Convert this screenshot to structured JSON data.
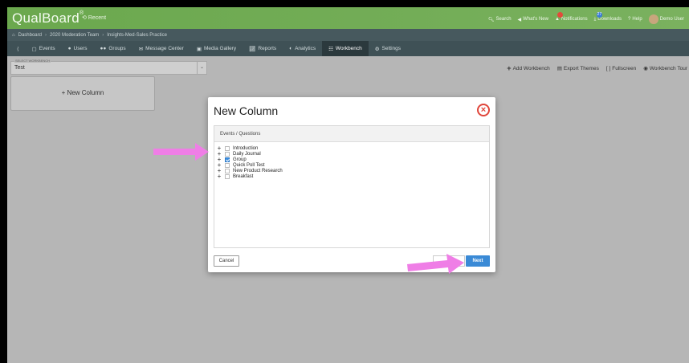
{
  "app": {
    "brand": "QualBoard",
    "brand_mark": "®",
    "recent": "Recent"
  },
  "topbar_right": {
    "search": "Search",
    "whats_new": "What's New",
    "notifications": "Notifications",
    "notifications_badge": "27",
    "downloads": "Downloads",
    "help": "Help",
    "user": "Demo User"
  },
  "breadcrumb": [
    "Dashboard",
    "2020 Moderation Team",
    "Insights-Med-Sales Practice"
  ],
  "nav": {
    "events": "Events",
    "users": "Users",
    "groups": "Groups",
    "message_center": "Message Center",
    "media_gallery": "Media Gallery",
    "reports": "Reports",
    "analytics": "Analytics",
    "workbench": "Workbench",
    "settings": "Settings"
  },
  "workbench_select": {
    "label": "SELECT WORKBENCH",
    "value": "Test"
  },
  "toolbar": {
    "add": "Add Workbench",
    "export": "Export Themes",
    "fullscreen": "Fullscreen",
    "tour": "Workbench Tour"
  },
  "new_column_card": "+ New Column",
  "modal": {
    "title": "New Column",
    "panel_header": "Events / Questions",
    "items": [
      {
        "label": "Introduction",
        "checked": false
      },
      {
        "label": "Daily Journal",
        "checked": false
      },
      {
        "label": "Group",
        "checked": true
      },
      {
        "label": "Quick Poll Test",
        "checked": false
      },
      {
        "label": "New Product Research",
        "checked": false
      },
      {
        "label": "Breakfast",
        "checked": false
      }
    ],
    "cancel": "Cancel",
    "next": "Next"
  },
  "colors": {
    "brand_green": "#6ba84e",
    "nav_dark": "#3f5156",
    "accent_blue": "#3a8ad6",
    "annotation_arrow": "#ef7ee6",
    "close_red": "#e0453a"
  }
}
